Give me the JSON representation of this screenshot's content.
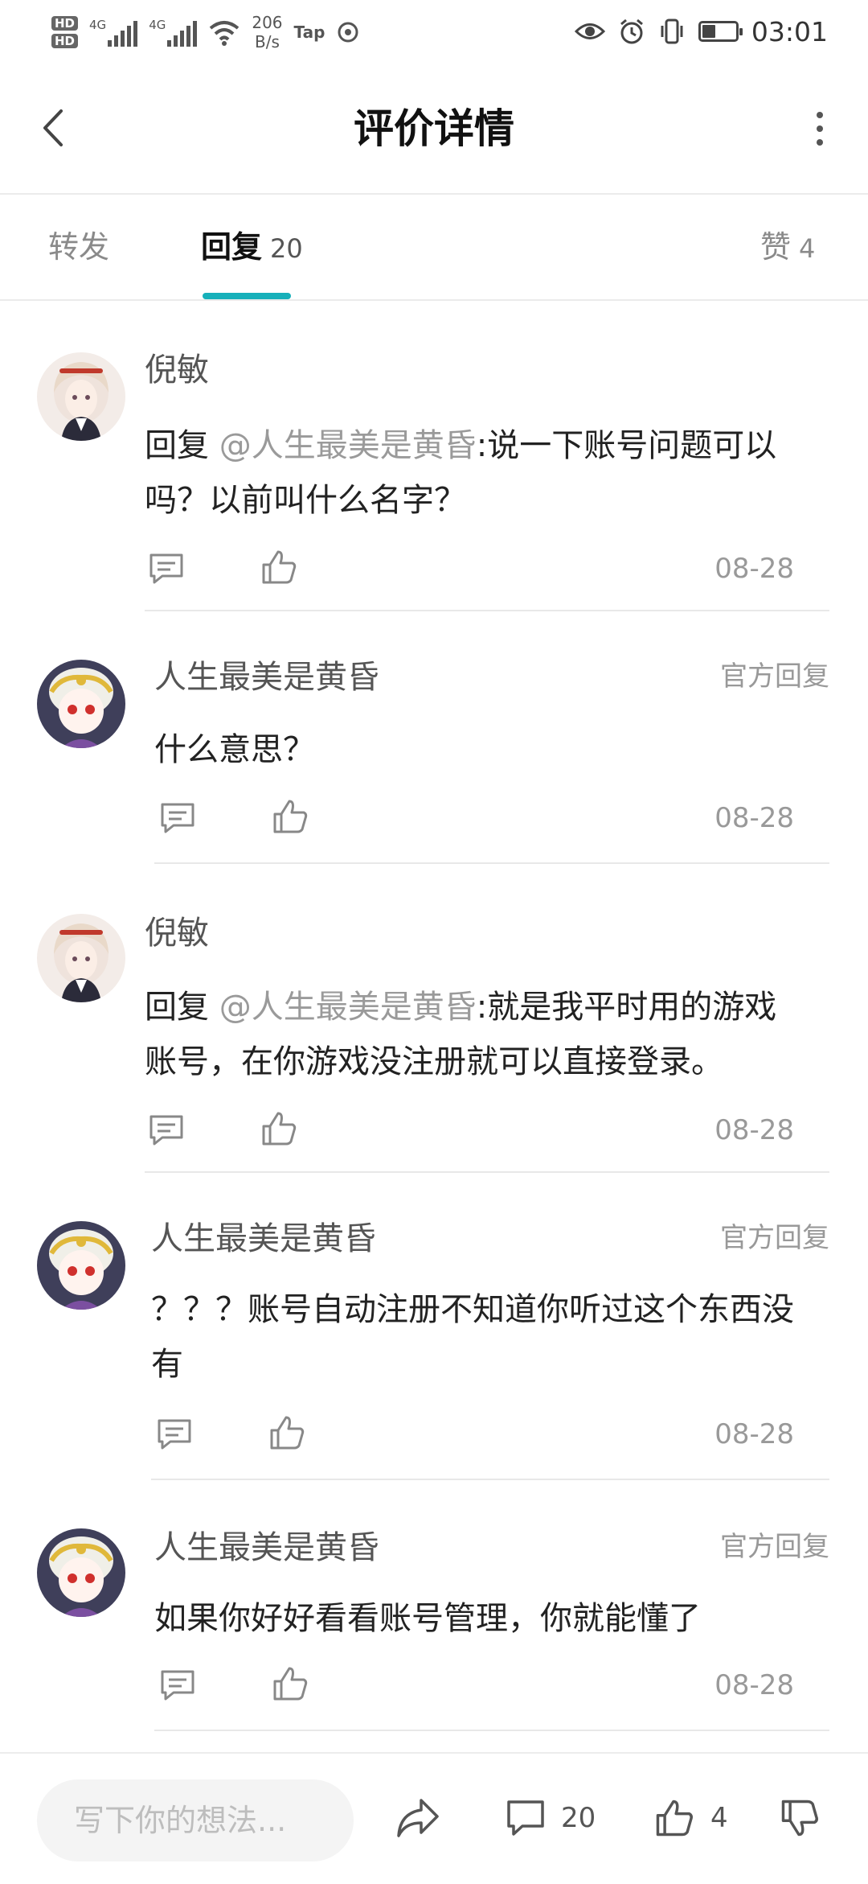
{
  "status_bar": {
    "hd1": "HD",
    "hd2": "HD",
    "net1": "4G",
    "net2": "4G",
    "speed_value": "206",
    "speed_unit": "B/s",
    "tap_label": "Tap",
    "time": "03:01",
    "battery_level": 0.4
  },
  "header": {
    "title": "评价详情"
  },
  "tabs": [
    {
      "label": "转发",
      "count": ""
    },
    {
      "label": "回复",
      "count": "20"
    },
    {
      "label": "赞",
      "count": "4"
    }
  ],
  "comments": [
    {
      "name": "倪敏",
      "official": "",
      "reply_prefix": "回复",
      "mention": "@人生最美是黄昏",
      "text_line1": ":说一下账号问题可以",
      "text_line2": "吗？以前叫什么名字？",
      "date": "08-28"
    },
    {
      "name": "人生最美是黄昏",
      "official": "官方回复",
      "text_line1": "什么意思？",
      "text_line2": "",
      "date": "08-28"
    },
    {
      "name": "倪敏",
      "official": "",
      "reply_prefix": "回复",
      "mention": "@人生最美是黄昏",
      "text_line1": ":就是我平时用的游戏",
      "text_line2": "账号，在你游戏没注册就可以直接登录。",
      "date": "08-28"
    },
    {
      "name": "人生最美是黄昏",
      "official": "官方回复",
      "text_line1": "？？？账号自动注册不知道你听过这个东西没",
      "text_line2": "有",
      "date": "08-28"
    },
    {
      "name": "人生最美是黄昏",
      "official": "官方回复",
      "text_line1": "如果你好好看看账号管理，你就能懂了",
      "text_line2": "",
      "date": "08-28"
    }
  ],
  "bottom_bar": {
    "input_placeholder": "写下你的想法...",
    "comment_count": "20",
    "like_count": "4"
  },
  "colors": {
    "accent": "#16b0ba",
    "muted_text": "#999999",
    "divider": "#e8e8e8"
  },
  "icons": [
    "back-arrow-icon",
    "more-vertical-icon",
    "comment-icon",
    "thumbs-up-icon",
    "share-icon",
    "thumbs-down-icon",
    "eye-icon",
    "alarm-icon",
    "vibrate-icon",
    "wifi-icon"
  ]
}
